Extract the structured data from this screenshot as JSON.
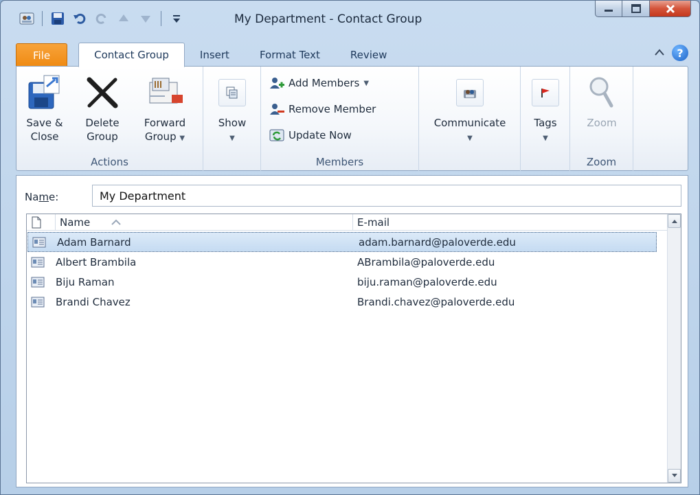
{
  "window": {
    "title": "My Department - Contact Group"
  },
  "ribbon": {
    "tabs": [
      {
        "label": "File"
      },
      {
        "label": "Contact Group"
      },
      {
        "label": "Insert"
      },
      {
        "label": "Format Text"
      },
      {
        "label": "Review"
      }
    ],
    "actions": {
      "save_close": "Save &\nClose",
      "save_line1": "Save &",
      "save_line2": "Close",
      "delete_line1": "Delete",
      "delete_line2": "Group",
      "forward_line1": "Forward",
      "forward_line2": "Group",
      "group_label": "Actions"
    },
    "show": {
      "label": "Show"
    },
    "members": {
      "add": "Add Members",
      "remove": "Remove Member",
      "update": "Update Now",
      "group_label": "Members"
    },
    "communicate": {
      "label": "Communicate"
    },
    "tags": {
      "label": "Tags"
    },
    "zoom": {
      "label": "Zoom",
      "group_label": "Zoom"
    }
  },
  "form": {
    "name_label_pre": "Na",
    "name_label_u": "m",
    "name_label_post": "e:",
    "name_value": "My Department"
  },
  "list": {
    "headers": {
      "name": "Name",
      "email": "E-mail"
    },
    "rows": [
      {
        "name": "Adam Barnard",
        "email": "adam.barnard@paloverde.edu"
      },
      {
        "name": "Albert Brambila",
        "email": "ABrambila@paloverde.edu"
      },
      {
        "name": "Biju Raman",
        "email": "biju.raman@paloverde.edu"
      },
      {
        "name": "Brandi Chavez",
        "email": "Brandi.chavez@paloverde.edu"
      }
    ]
  },
  "colors": {
    "file_tab": "#ef8a12",
    "selection": "#c5dbf2",
    "close_button": "#c4371c"
  }
}
